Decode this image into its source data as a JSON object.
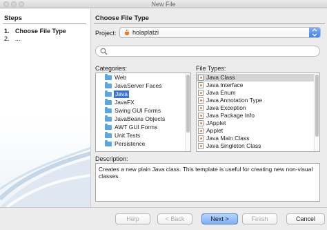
{
  "window": {
    "title": "New File"
  },
  "steps": {
    "title": "Steps",
    "items": [
      {
        "num": "1.",
        "label": "Choose File Type"
      },
      {
        "num": "2.",
        "label": "..."
      }
    ]
  },
  "main": {
    "title": "Choose File Type",
    "project_label": "Project:",
    "project_value": "holaplatzi",
    "search_value": "",
    "categories_label": "Categories:",
    "categories": [
      "Web",
      "JavaServer Faces",
      "Java",
      "JavaFX",
      "Swing GUI Forms",
      "JavaBeans Objects",
      "AWT GUI Forms",
      "Unit Tests",
      "Persistence"
    ],
    "selected_category": "Java",
    "file_types_label": "File Types:",
    "file_types": [
      "Java Class",
      "Java Interface",
      "Java Enum",
      "Java Annotation Type",
      "Java Exception",
      "Java Package Info",
      "JApplet",
      "Applet",
      "Java Main Class",
      "Java Singleton Class"
    ],
    "selected_file_type": "Java Class",
    "description_label": "Description:",
    "description_text": "Creates a new plain Java class. This template is useful for creating new non-visual classes."
  },
  "buttons": {
    "help": "Help",
    "back": "< Back",
    "next": "Next >",
    "finish": "Finish",
    "cancel": "Cancel"
  },
  "colors": {
    "selection": "#3875d7",
    "folder": "#5aa7e6",
    "default_button": "#7eb0f8"
  }
}
